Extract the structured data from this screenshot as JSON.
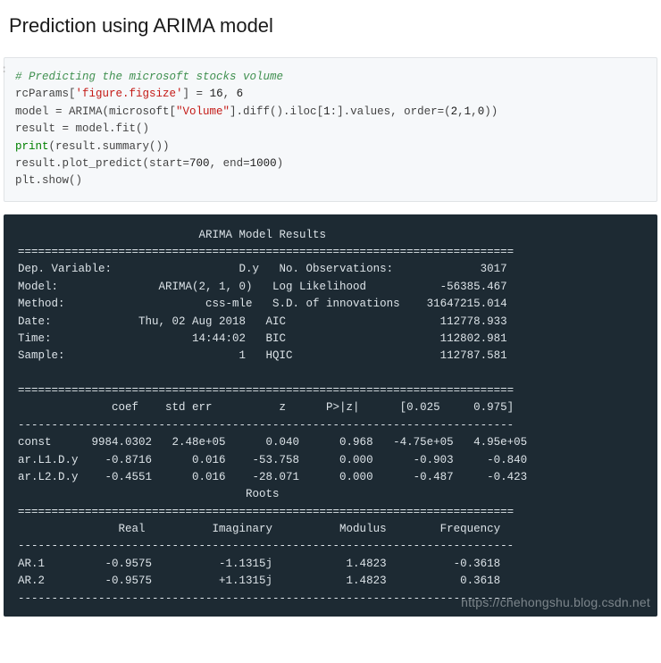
{
  "title": "Prediction using ARIMA model",
  "code": {
    "line1_comment": "# Predicting the microsoft stocks volume",
    "line2_a": "rcParams[",
    "line2_str": "'figure.figsize'",
    "line2_b": "] = ",
    "line2_n1": "16",
    "line2_c": ", ",
    "line2_n2": "6",
    "line3_a": "model = ARIMA(microsoft[",
    "line3_str": "\"Volume\"",
    "line3_b": "].diff().iloc[",
    "line3_n1": "1",
    "line3_c": ":].values, order=(",
    "line3_n2": "2",
    "line3_d": ",",
    "line3_n3": "1",
    "line3_e": ",",
    "line3_n4": "0",
    "line3_f": "))",
    "line4": "result = model.fit()",
    "line5_fn": "print",
    "line5_b": "(result.summary())",
    "line6_a": "result.plot_predict(start=",
    "line6_n1": "700",
    "line6_b": ", end=",
    "line6_n2": "1000",
    "line6_c": ")",
    "line7": "plt.show()"
  },
  "output": {
    "title_line": "                           ARIMA Model Results                            ",
    "sep_eq": "==========================================================================",
    "row_dep": "Dep. Variable:                   D.y   No. Observations:             3017",
    "row_model": "Model:               ARIMA(2, 1, 0)   Log Likelihood           -56385.467",
    "row_method": "Method:                     css-mle   S.D. of innovations    31647215.014",
    "row_date": "Date:             Thu, 02 Aug 2018   AIC                       112778.933",
    "row_time": "Time:                     14:44:02   BIC                       112802.981",
    "row_sample": "Sample:                          1   HQIC                      112787.581",
    "blank": "",
    "hdr_coef": "              coef    std err          z      P>|z|      [0.025     0.975]",
    "sep_dash": "--------------------------------------------------------------------------",
    "row_const": "const      9984.0302   2.48e+05      0.040      0.968   -4.75e+05   4.95e+05",
    "row_ar1": "ar.L1.D.y    -0.8716      0.016    -53.758      0.000      -0.903     -0.840",
    "row_ar2": "ar.L2.D.y    -0.4551      0.016    -28.071      0.000      -0.487     -0.423",
    "roots_title": "                                  Roots                                   ",
    "hdr_roots": "               Real          Imaginary          Modulus        Frequency",
    "row_root1": "AR.1         -0.9575          -1.1315j           1.4823          -0.3618",
    "row_root2": "AR.2         -0.9575          +1.1315j           1.4823           0.3618"
  },
  "watermark": "https://chehongshu.blog.csdn.net",
  "gutter": ":"
}
